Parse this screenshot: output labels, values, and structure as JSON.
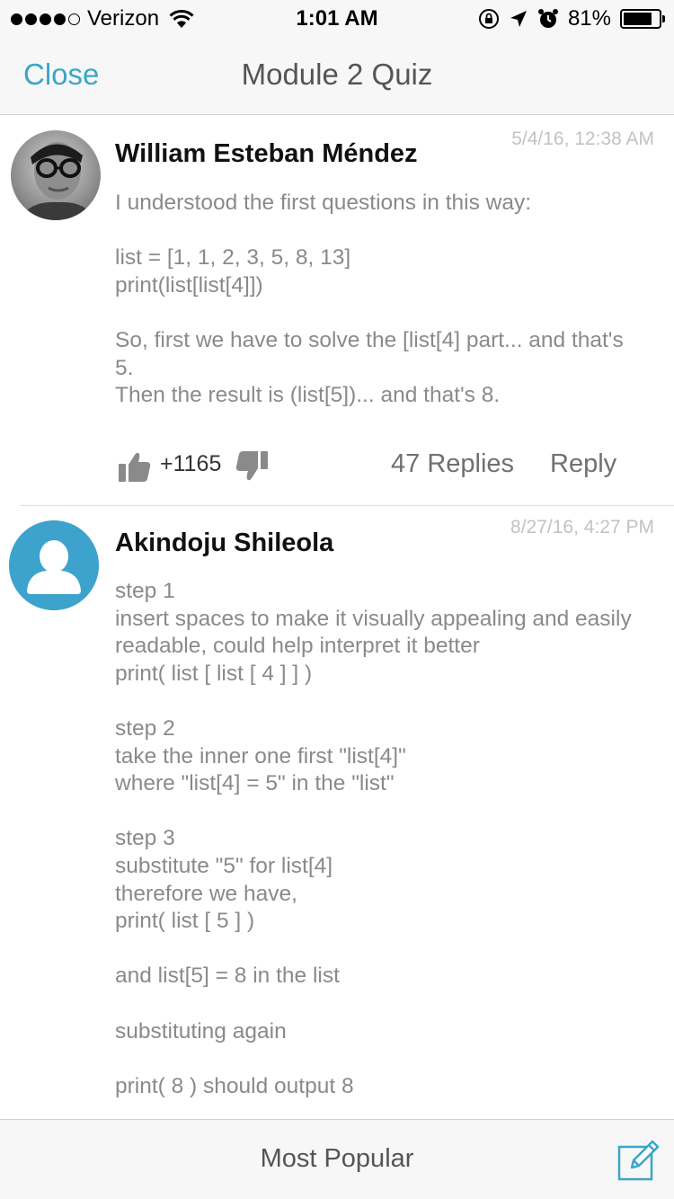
{
  "status_bar": {
    "carrier": "Verizon",
    "time": "1:01 AM",
    "battery": "81%",
    "icons": [
      "wifi-icon",
      "orientation-lock-icon",
      "location-arrow-icon",
      "alarm-icon",
      "battery-icon"
    ]
  },
  "nav": {
    "close_label": "Close",
    "title": "Module 2 Quiz"
  },
  "comments": [
    {
      "author": "William Esteban Méndez",
      "timestamp": "5/4/16, 12:38 AM",
      "body": "I understood the first questions in this way:\n\nlist = [1, 1, 2, 3, 5, 8, 13]\nprint(list[list[4]])\n\nSo, first we have to solve the [list[4] part... and that's 5.\nThen the result is (list[5])... and that's 8.",
      "score": "+1165",
      "replies_label": "47 Replies",
      "reply_label": "Reply"
    },
    {
      "author": "Akindoju Shileola",
      "timestamp": "8/27/16, 4:27 PM",
      "body": "step 1\ninsert spaces to make it visually appealing and easily readable, could help interpret it better\nprint( list [ list [ 4 ] ] )\n\nstep 2\ntake the inner one first \"list[4]\"\nwhere \"list[4] = 5\"   in the \"list\"\n\nstep 3\nsubstitute \"5\" for list[4]\ntherefore we have,\nprint( list [ 5 ] )\n\nand list[5] = 8 in the list\n\nsubstituting again\n\nprint( 8 ) should output 8"
    }
  ],
  "bottom_bar": {
    "sort_label": "Most Popular"
  },
  "colors": {
    "accent": "#3ba6c8",
    "avatar_default": "#3ea3cc"
  }
}
